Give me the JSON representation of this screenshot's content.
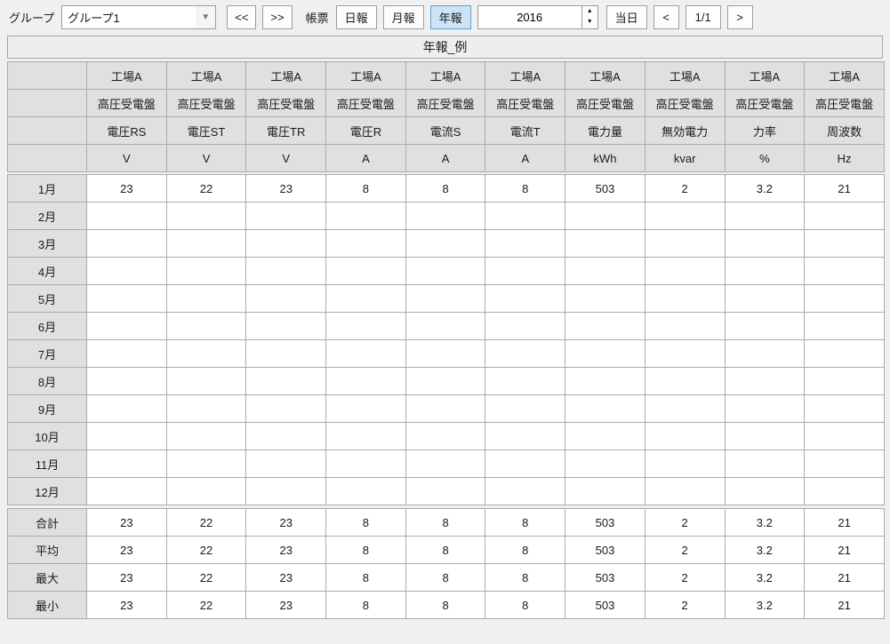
{
  "toolbar": {
    "group_label": "グループ",
    "group_value": "グループ1",
    "prev_group": "<<",
    "next_group": ">>",
    "report_label": "帳票",
    "daily": "日報",
    "monthly": "月報",
    "yearly": "年報",
    "selected_report": "年報",
    "year": "2016",
    "today": "当日",
    "page_prev": "<",
    "page": "1/1",
    "page_next": ">",
    "selected_color": "#cce4f7"
  },
  "icons": {
    "dropdown_arrow": "▼",
    "spin_up": "▲",
    "spin_down": "▼"
  },
  "report": {
    "title": "年報_例"
  },
  "table": {
    "header": {
      "site_row": [
        "工場A",
        "工場A",
        "工場A",
        "工場A",
        "工場A",
        "工場A",
        "工場A",
        "工場A",
        "工場A",
        "工場A"
      ],
      "panel_row": [
        "高圧受電盤",
        "高圧受電盤",
        "高圧受電盤",
        "高圧受電盤",
        "高圧受電盤",
        "高圧受電盤",
        "高圧受電盤",
        "高圧受電盤",
        "高圧受電盤",
        "高圧受電盤"
      ],
      "measure_row": [
        "電圧RS",
        "電圧ST",
        "電圧TR",
        "電圧R",
        "電流S",
        "電流T",
        "電力量",
        "無効電力",
        "力率",
        "周波数"
      ],
      "unit_row": [
        "V",
        "V",
        "V",
        "A",
        "A",
        "A",
        "kWh",
        "kvar",
        "%",
        "Hz"
      ]
    },
    "months": [
      {
        "label": "1月",
        "values": [
          "23",
          "22",
          "23",
          "8",
          "8",
          "8",
          "503",
          "2",
          "3.2",
          "21"
        ]
      },
      {
        "label": "2月",
        "values": [
          "",
          "",
          "",
          "",
          "",
          "",
          "",
          "",
          "",
          ""
        ]
      },
      {
        "label": "3月",
        "values": [
          "",
          "",
          "",
          "",
          "",
          "",
          "",
          "",
          "",
          ""
        ]
      },
      {
        "label": "4月",
        "values": [
          "",
          "",
          "",
          "",
          "",
          "",
          "",
          "",
          "",
          ""
        ]
      },
      {
        "label": "5月",
        "values": [
          "",
          "",
          "",
          "",
          "",
          "",
          "",
          "",
          "",
          ""
        ]
      },
      {
        "label": "6月",
        "values": [
          "",
          "",
          "",
          "",
          "",
          "",
          "",
          "",
          "",
          ""
        ]
      },
      {
        "label": "7月",
        "values": [
          "",
          "",
          "",
          "",
          "",
          "",
          "",
          "",
          "",
          ""
        ]
      },
      {
        "label": "8月",
        "values": [
          "",
          "",
          "",
          "",
          "",
          "",
          "",
          "",
          "",
          ""
        ]
      },
      {
        "label": "9月",
        "values": [
          "",
          "",
          "",
          "",
          "",
          "",
          "",
          "",
          "",
          ""
        ]
      },
      {
        "label": "10月",
        "values": [
          "",
          "",
          "",
          "",
          "",
          "",
          "",
          "",
          "",
          ""
        ]
      },
      {
        "label": "11月",
        "values": [
          "",
          "",
          "",
          "",
          "",
          "",
          "",
          "",
          "",
          ""
        ]
      },
      {
        "label": "12月",
        "values": [
          "",
          "",
          "",
          "",
          "",
          "",
          "",
          "",
          "",
          ""
        ]
      }
    ],
    "summary": [
      {
        "label": "合計",
        "values": [
          "23",
          "22",
          "23",
          "8",
          "8",
          "8",
          "503",
          "2",
          "3.2",
          "21"
        ]
      },
      {
        "label": "平均",
        "values": [
          "23",
          "22",
          "23",
          "8",
          "8",
          "8",
          "503",
          "2",
          "3.2",
          "21"
        ]
      },
      {
        "label": "最大",
        "values": [
          "23",
          "22",
          "23",
          "8",
          "8",
          "8",
          "503",
          "2",
          "3.2",
          "21"
        ]
      },
      {
        "label": "最小",
        "values": [
          "23",
          "22",
          "23",
          "8",
          "8",
          "8",
          "503",
          "2",
          "3.2",
          "21"
        ]
      }
    ]
  }
}
